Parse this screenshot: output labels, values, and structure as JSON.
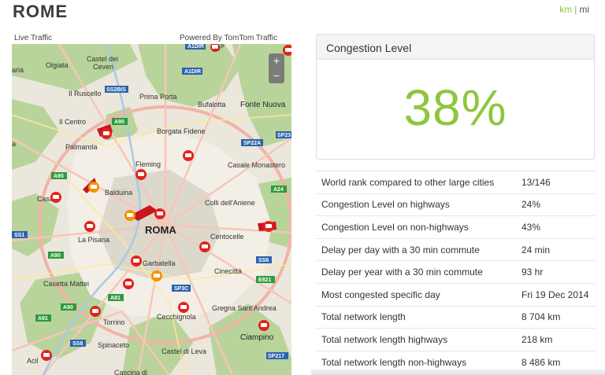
{
  "header": {
    "city": "ROME",
    "unit_km": "km",
    "unit_sep": "|",
    "unit_mi": "mi"
  },
  "map": {
    "left_label": "Live Traffic",
    "right_label": "Powered By TomTom Traffic",
    "zoom_in": "+",
    "zoom_out": "−",
    "labels": {
      "olgiata": "Olgiata",
      "castel_dei_ceveri": "Castel dei",
      "ceveri": "Ceveri",
      "a1dir_top": "A1DIR",
      "a1dir": "A1DIR",
      "via_salaria": "Via Sala",
      "aria": "aria",
      "il_ruscello": "Il Ruscello",
      "ss2bis": "SS2BIS",
      "prima_porta": "Prima Porta",
      "bufalotta": "Bufalotta",
      "fonte_nuova": "Fonte Nuova",
      "il_centro": "Il Centro",
      "a90_a": "A90",
      "borgata_fidene": "Borgata Fidene",
      "palmarola": "Palmarola",
      "sp22a": "SP22A",
      "sp23": "SP23",
      "a_left": "a",
      "fleming": "Fleming",
      "casale_monastero": "Casale Monastero",
      "a90_b": "A90",
      "balduina": "Balduina",
      "a24": "A24",
      "casa": "Casa",
      "colli_aniene": "Colli dell'Aniene",
      "ss1": "SS1",
      "roma": "ROMA",
      "la_pisana": "La Pisana",
      "centocelle": "Centocelle",
      "a90_c": "A90",
      "ss6": "SS6",
      "garbatella": "Garbatella",
      "casetta_mattei": "Casetta Mattei",
      "sp3c": "SP3C",
      "cinecitta": "Cinecittà",
      "e821": "E821",
      "a91_a": "A91",
      "a90_d": "A90",
      "gregna": "Gregna Sant'Andrea",
      "a91_b": "A91",
      "torrino": "Torrino",
      "cecchignola": "Cecchignola",
      "ciampino": "Ciampino",
      "ss8": "SS8",
      "spinaceto": "Spinaceto",
      "castel_di_leva": "Castel di Leva",
      "sp217": "SP217",
      "acil": "Acil",
      "cascina": "Cascina di"
    }
  },
  "congestion": {
    "title": "Congestion Level",
    "value": "38%"
  },
  "stats": [
    {
      "label": "World rank compared to other large cities",
      "value": "13/146"
    },
    {
      "label": "Congestion Level on highways",
      "value": "24%"
    },
    {
      "label": "Congestion Level on non-highways",
      "value": "43%"
    },
    {
      "label": "Delay per day with a 30 min commute",
      "value": "24 min"
    },
    {
      "label": "Delay per year with a 30 min commute",
      "value": "93 hr"
    },
    {
      "label": "Most congested specific day",
      "value": "Fri 19 Dec 2014"
    },
    {
      "label": "Total network length",
      "value": "8 704 km"
    },
    {
      "label": "Total network length highways",
      "value": "218 km"
    },
    {
      "label": "Total network length non-highways",
      "value": "8 486 km"
    }
  ],
  "colors": {
    "accent_green": "#8dc63f",
    "incident_red": "#e2231a",
    "incident_orange": "#f39200",
    "ring_road": "#f2b3a6",
    "park_green": "#b5d29a"
  }
}
